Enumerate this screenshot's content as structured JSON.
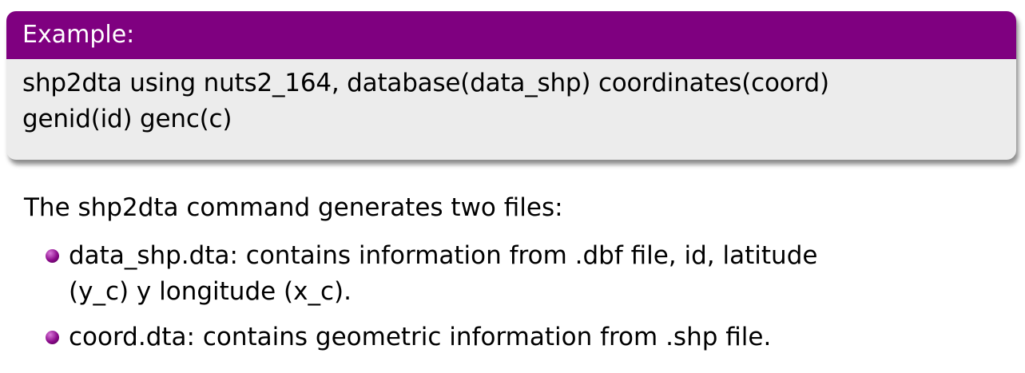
{
  "example": {
    "title": "Example:",
    "code_line1": "shp2dta using nuts2_164, database(data_shp) coordinates(coord)",
    "code_line2": "genid(id) genc(c)"
  },
  "intro": "The shp2dta command generates two files:",
  "bullets": [
    {
      "line1": "data_shp.dta: contains information from .dbf file, id, latitude",
      "line2": "(y_c) y longitude (x_c)."
    },
    {
      "line1": "coord.dta: contains geometric information from .shp file."
    }
  ],
  "colors": {
    "header_bg": "#7f0080",
    "body_bg": "#ececec",
    "bullet": "#8a0a8a"
  },
  "icons": {
    "bullet": "purple-ball-bullet"
  }
}
